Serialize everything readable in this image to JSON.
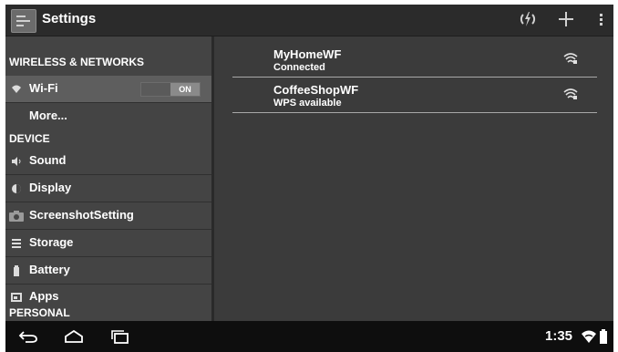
{
  "app_bar": {
    "title": "Settings",
    "icons": [
      "settings-app-icon",
      "refresh-icon",
      "add-icon",
      "overflow-menu-icon"
    ]
  },
  "sidebar": {
    "sections": {
      "wireless": "WIRELESS & NETWORKS",
      "device": "DEVICE",
      "personal": "PERSONAL"
    },
    "items": [
      {
        "label": "Wi-Fi",
        "icon": "wifi-icon",
        "toggle": "ON",
        "selected": true
      },
      {
        "label": "More...",
        "icon": "",
        "selected": false
      },
      {
        "label": "Sound",
        "icon": "speaker-icon",
        "selected": false
      },
      {
        "label": "Display",
        "icon": "brightness-icon",
        "selected": false
      },
      {
        "label": "ScreenshotSetting",
        "icon": "camera-icon",
        "selected": false
      },
      {
        "label": "Storage",
        "icon": "storage-icon",
        "selected": false
      },
      {
        "label": "Battery",
        "icon": "battery-icon",
        "selected": false
      },
      {
        "label": "Apps",
        "icon": "apps-icon",
        "selected": false
      }
    ]
  },
  "networks": [
    {
      "name": "MyHomeWF",
      "status": "Connected",
      "icon": "wifi-signal-icon"
    },
    {
      "name": "CoffeeShopWF",
      "status": "WPS available",
      "icon": "wifi-signal-icon"
    }
  ],
  "status_bar": {
    "time": "1:35",
    "icons": [
      "back-icon",
      "home-icon",
      "recent-apps-icon",
      "wifi-status-icon",
      "battery-status-icon"
    ]
  },
  "colors": {
    "background": "#3a3a3a",
    "action_bar": "#2b2b2b",
    "sidebar": "#444444",
    "selected_item": "#5e5e5e",
    "nav_bar": "#0e0e0e",
    "text": "#ffffff"
  }
}
